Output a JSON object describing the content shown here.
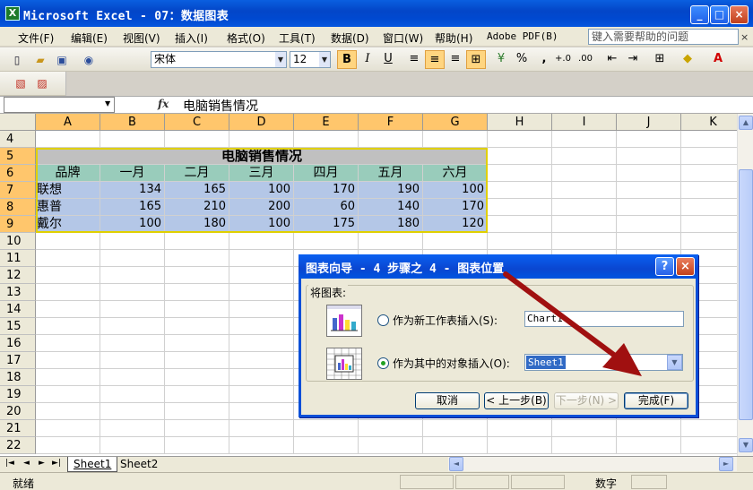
{
  "window": {
    "title": "Microsoft Excel - 07：数据图表",
    "app_icon": "X",
    "minimize": "_",
    "maximize": "□",
    "close": "×"
  },
  "menu": {
    "items": [
      "文件(F)",
      "编辑(E)",
      "视图(V)",
      "插入(I)",
      "格式(O)",
      "工具(T)",
      "数据(D)",
      "窗口(W)",
      "帮助(H)",
      "Adobe PDF(B)"
    ],
    "help_placeholder": "键入需要帮助的问题",
    "close": "×"
  },
  "toolbar": {
    "font_name": "宋体",
    "font_size": "12",
    "bold": "B",
    "italic": "I",
    "underline": "U",
    "percent": "%",
    "comma": ",",
    "inc_decimal": "+.0",
    "dec_decimal": ".00"
  },
  "formula_bar": {
    "name_box": "",
    "fx": "fx",
    "content": "电脑销售情况"
  },
  "sheet": {
    "columns": [
      "A",
      "B",
      "C",
      "D",
      "E",
      "F",
      "G",
      "H",
      "I",
      "J",
      "K"
    ],
    "rows": [
      "4",
      "5",
      "6",
      "7",
      "8",
      "9",
      "10",
      "11",
      "12",
      "13",
      "14",
      "15",
      "16",
      "17",
      "18",
      "19",
      "20",
      "21",
      "22"
    ],
    "table_title": "电脑销售情况",
    "headers": [
      "品牌",
      "一月",
      "二月",
      "三月",
      "四月",
      "五月",
      "六月"
    ],
    "data": [
      [
        "联想",
        "134",
        "165",
        "100",
        "170",
        "190",
        "100"
      ],
      [
        "惠普",
        "165",
        "210",
        "200",
        "60",
        "140",
        "170"
      ],
      [
        "戴尔",
        "100",
        "180",
        "100",
        "175",
        "180",
        "120"
      ]
    ]
  },
  "tabs": {
    "nav": [
      "|◄",
      "◄",
      "►",
      "►|"
    ],
    "sheets": [
      "Sheet1",
      "Sheet2"
    ]
  },
  "status": {
    "ready": "就绪",
    "mode": "数字"
  },
  "dialog": {
    "title": "图表向导 - 4 步骤之 4 - 图表位置",
    "help": "?",
    "close": "×",
    "group_label": "将图表:",
    "option_new_sheet": "作为新工作表插入(S):",
    "new_sheet_value": "Chart1",
    "option_object": "作为其中的对象插入(O):",
    "object_value": "Sheet1",
    "buttons": {
      "cancel": "取消",
      "back": "< 上一步(B)",
      "next": "下一步(N) >",
      "finish": "完成(F)"
    }
  },
  "colors": {
    "title_blue": "#0a5fe0",
    "selected_header": "#ffc66c",
    "table_blue": "#b4c7e7",
    "table_teal": "#99ccbb",
    "arrow_red": "#a01010"
  }
}
